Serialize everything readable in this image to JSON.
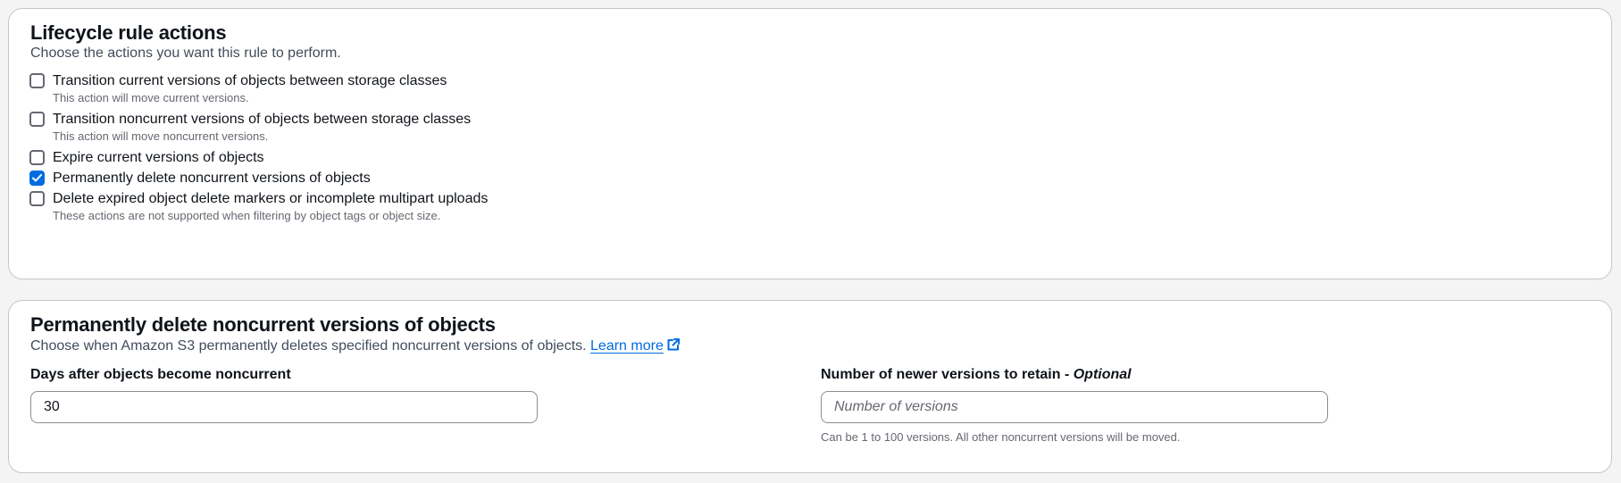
{
  "actions_card": {
    "title": "Lifecycle rule actions",
    "description": "Choose the actions you want this rule to perform.",
    "options": [
      {
        "label": "Transition current versions of objects between storage classes",
        "hint": "This action will move current versions.",
        "checked": false
      },
      {
        "label": "Transition noncurrent versions of objects between storage classes",
        "hint": "This action will move noncurrent versions.",
        "checked": false
      },
      {
        "label": "Expire current versions of objects",
        "hint": "",
        "checked": false
      },
      {
        "label": "Permanently delete noncurrent versions of objects",
        "hint": "",
        "checked": true
      },
      {
        "label": "Delete expired object delete markers or incomplete multipart uploads",
        "hint": "These actions are not supported when filtering by object tags or object size.",
        "checked": false
      }
    ]
  },
  "delete_card": {
    "title": "Permanently delete noncurrent versions of objects",
    "description": "Choose when Amazon S3 permanently deletes specified noncurrent versions of objects.",
    "learn_more": "Learn more",
    "days_field": {
      "label": "Days after objects become noncurrent",
      "value": "30"
    },
    "versions_field": {
      "label": "Number of newer versions to retain - ",
      "label_optional": "Optional",
      "placeholder": "Number of versions",
      "value": "",
      "hint": "Can be 1 to 100 versions. All other noncurrent versions will be moved."
    }
  },
  "colors": {
    "accent": "#006ce0",
    "border": "#c6c6cd",
    "text": "#0f141a",
    "muted": "#656871"
  },
  "icons": {
    "checkbox_checked": "check-icon",
    "external_link": "external-link-icon"
  }
}
